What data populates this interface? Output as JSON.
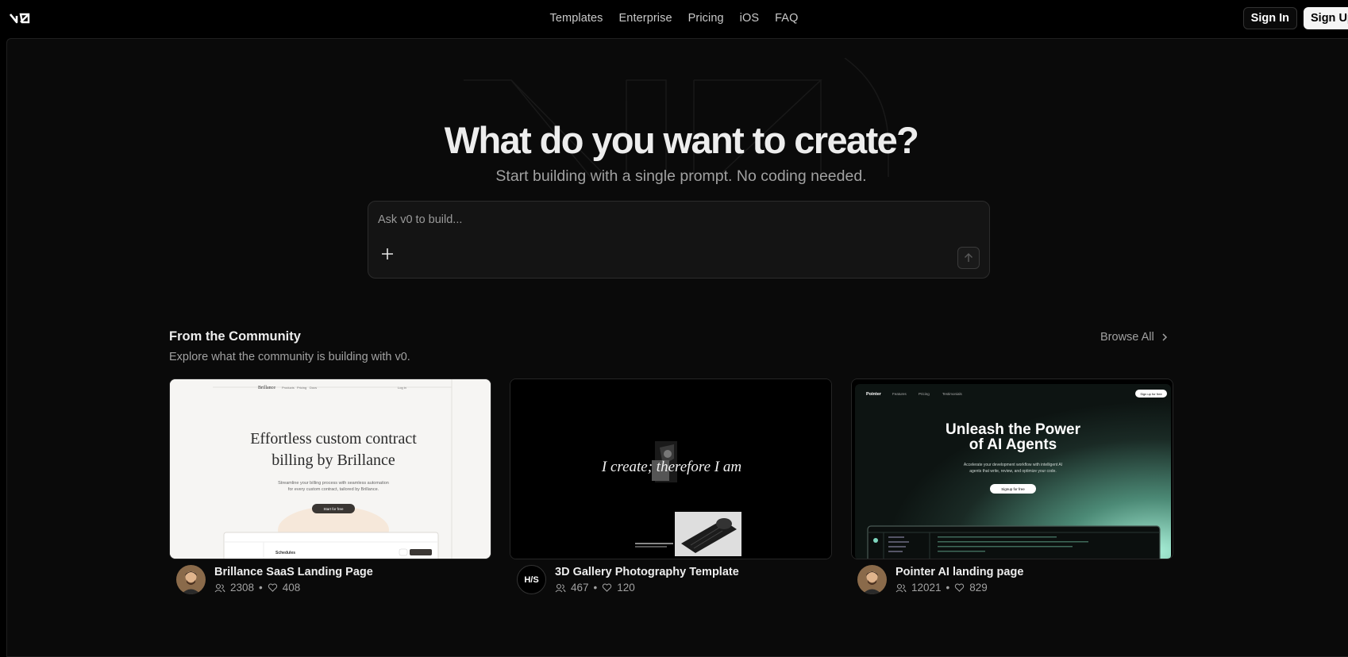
{
  "nav": {
    "links": [
      "Templates",
      "Enterprise",
      "Pricing",
      "iOS",
      "FAQ"
    ],
    "sign_in": "Sign In",
    "sign_up": "Sign Up"
  },
  "hero": {
    "title": "What do you want to create?",
    "subtitle": "Start building with a single prompt. No coding needed.",
    "prompt_placeholder": "Ask v0 to build..."
  },
  "community": {
    "title": "From the Community",
    "subtitle": "Explore what the community is building with v0.",
    "browse_all": "Browse All",
    "cards": [
      {
        "title": "Brillance SaaS Landing Page",
        "views": "2308",
        "likes": "408",
        "preview": {
          "brand": "Brillance",
          "nav": [
            "Products",
            "Pricing",
            "Docs"
          ],
          "login": "Log in",
          "headline_1": "Effortless custom contract",
          "headline_2": "billing by Brillance",
          "body_1": "Streamline your billing process with seamless automation",
          "body_2": "for every custom contract, tailored by Brillance.",
          "cta": "Start for free",
          "inner_heading": "Schedules"
        }
      },
      {
        "title": "3D Gallery Photography Template",
        "views": "467",
        "likes": "120",
        "avatar_text": "H/S",
        "preview": {
          "headline": "I create; therefore I am"
        }
      },
      {
        "title": "Pointer AI landing page",
        "views": "12021",
        "likes": "829",
        "preview": {
          "brand": "Pointer",
          "nav": [
            "Features",
            "Pricing",
            "Testimonials"
          ],
          "signup_top": "Sign up for free",
          "headline_1": "Unleash the Power",
          "headline_2": "of AI Agents",
          "body_1": "Accelerate your development workflow with intelligent AI",
          "body_2": "agents that write, review, and optimize your code.",
          "cta": "Signup for free"
        }
      }
    ]
  },
  "colors": {
    "background": "#000000",
    "panel": "#0a0a0a",
    "text": "#ededed",
    "muted": "#a1a1a1",
    "pointer_glow": "#a8f0d8"
  }
}
